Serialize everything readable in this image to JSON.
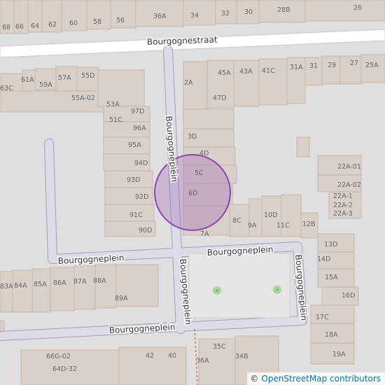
{
  "map": {
    "streets": {
      "top": "Bourgognestraat",
      "middle": "Bourgogneplein",
      "vertical_left": "Bourgogneplein",
      "vertical_right": "Bourgogneplein",
      "bottom": "Bourgogneplein",
      "upper_vertical": "Bourgogneplein"
    },
    "house_numbers": [
      "68",
      "66",
      "64",
      "62",
      "60",
      "58",
      "56",
      "36A",
      "34",
      "32",
      "30",
      "28B",
      "26",
      "61A",
      "63C",
      "59A",
      "57A",
      "55D",
      "55A-02",
      "53A",
      "97D",
      "51C",
      "96A",
      "95A",
      "94D",
      "93D",
      "92D",
      "91C",
      "90D",
      "2A",
      "45A",
      "43A",
      "41C",
      "31A",
      "31",
      "29",
      "27",
      "25A",
      "47D",
      "3D",
      "4D",
      "5C",
      "6D",
      "7A",
      "8C",
      "9A",
      "10D",
      "11C",
      "12B",
      "22A-01",
      "22A-02",
      "22A-1",
      "22A-2",
      "22A-3",
      "13D",
      "14D",
      "15A",
      "16D",
      "17C",
      "18A",
      "19A",
      "83A",
      "84A",
      "85A",
      "86A",
      "87A",
      "88A",
      "89A",
      "66G-02",
      "64D-32",
      "42",
      "40",
      "35C",
      "36A",
      "34B"
    ],
    "marker": {
      "type": "circle",
      "color": "#9b59b6"
    },
    "attribution": "OpenStreetMap contributors",
    "attribution_symbol": "©"
  },
  "colors": {
    "background": "#e0dfdf",
    "building": "#d9d0c9",
    "building_stroke": "#c4b6ab",
    "road": "#ffffff",
    "footway": "#d8d8e8",
    "green_point": "#aad3a2"
  }
}
